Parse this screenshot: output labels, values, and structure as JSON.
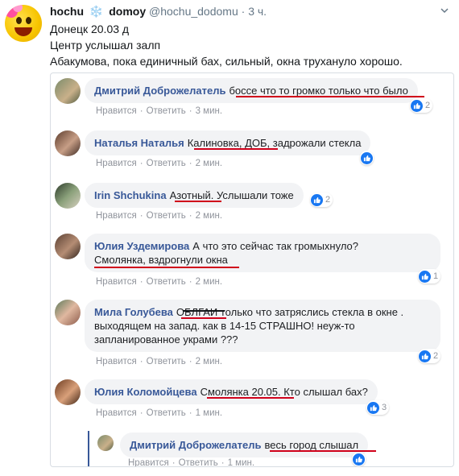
{
  "tweet": {
    "name_part1": "hochu",
    "snow_glyph": "❄️",
    "name_part2": "domoy",
    "handle": "@hochu_dodomu",
    "time": "· 3 ч.",
    "line1": "Донецк 20.03  д",
    "line2": "Центр услышал залп",
    "line3": "Абакумова, пока единичный бах, сильный, окна труханулo хорошо."
  },
  "actions": {
    "like": "Нравится",
    "reply": "Ответить",
    "dot": "·"
  },
  "comments": [
    {
      "author": "Дмитрий Доброжелатель",
      "text": "боссе что то громко только что было",
      "time": "3 мин.",
      "likes": "2"
    },
    {
      "author": "Наталья Наталья",
      "text": "Калиновка, ДОБ, задрожали стекла",
      "time": "2 мин.",
      "likes": ""
    },
    {
      "author": "Irin Shchukina",
      "text": "Азотный. Услышали тоже",
      "time": "2 мин.",
      "likes": "2"
    },
    {
      "author": "Юлия Уздемирова",
      "text1": "А что это сейчас так громыхнуло?",
      "text2": "Смолянка, вздрогнули окна",
      "time": "2 мин.",
      "likes": "1"
    },
    {
      "author": "Мила Голубева",
      "text1": "ОБЛГАИ только что затряслись стекла в окне .",
      "text2": "выходящем на запад. как в 14-15 СТРАШНО! неуж-то",
      "text3": "запланированное украми ???",
      "time": "2 мин.",
      "likes": "2"
    },
    {
      "author": "Юлия Коломойцева",
      "text": "Смолянка 20.05. Кто слышал бах?",
      "time": "1 мин.",
      "likes": "3"
    },
    {
      "author": "Дмитрий Доброжелатель",
      "text": "весь город слышал",
      "time": "1 мин.",
      "likes": ""
    }
  ],
  "colors": {
    "accent": "#385898",
    "like": "#1877f2",
    "underline": "#d0021b"
  }
}
